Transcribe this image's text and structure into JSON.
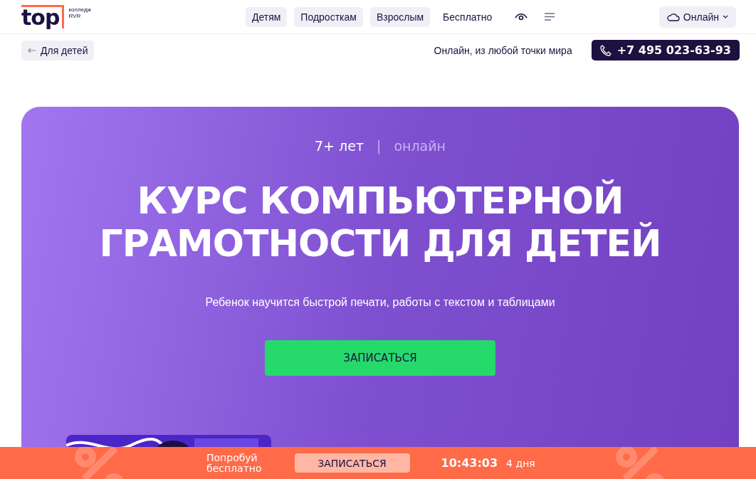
{
  "header": {
    "logo": {
      "text": "top",
      "subtitle_1": "колледж",
      "subtitle_2": "RVR"
    },
    "nav": [
      {
        "label": "Детям",
        "kind": "pill"
      },
      {
        "label": "Подросткам",
        "kind": "pill"
      },
      {
        "label": "Взрослым",
        "kind": "pill"
      },
      {
        "label": "Бесплатно",
        "kind": "plain"
      }
    ],
    "mode_button": {
      "label": "Онлайн"
    }
  },
  "subheader": {
    "back_button": {
      "label": "Для детей"
    },
    "location": "Онлайн, из любой точки мира",
    "phone": "+7 495 023-63-93"
  },
  "hero": {
    "age": "7+ лет",
    "separator": "|",
    "format": "онлайн",
    "title_lines": [
      "КУРС КОМПЬЮТЕРНОЙ",
      "ГРАМОТНОСТИ ДЛЯ ДЕТЕЙ"
    ],
    "subtitle": "Ребенок научится быстрой печати, работы с текстом и таблицами",
    "cta": "ЗАПИСАТЬСЯ"
  },
  "promo_bar": {
    "text_lines": [
      "Попробуй",
      "бесплатно"
    ],
    "cta": "ЗАПИСАТЬСЯ",
    "timer": "10:43:03",
    "days": "4 дня"
  }
}
